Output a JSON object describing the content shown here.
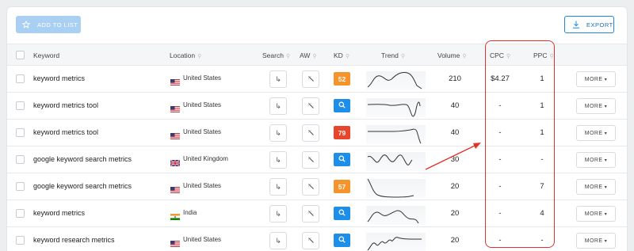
{
  "toolbar": {
    "add_to_list": "ADD TO LIST",
    "export": "EXPORT"
  },
  "columns": {
    "keyword": "Keyword",
    "location": "Location",
    "search": "Search",
    "aw": "AW",
    "kd": "KD",
    "trend": "Trend",
    "volume": "Volume",
    "cpc": "CPC",
    "ppc": "PPC",
    "pin_icon": "pin-icon"
  },
  "colors": {
    "kd_orange": "#f7932b",
    "kd_red": "#e9452c",
    "kd_blue": "#1e8fe8",
    "primary": "#1e88d8",
    "highlight": "#e0322a"
  },
  "rows": [
    {
      "keyword": "keyword metrics",
      "flag": "us",
      "location": "United States",
      "kd": "52",
      "kd_type": "orange",
      "volume": "210",
      "cpc": "$4.27",
      "ppc": "1",
      "more": "MORE"
    },
    {
      "keyword": "keyword metrics tool",
      "flag": "us",
      "location": "United States",
      "kd": "",
      "kd_type": "search",
      "volume": "40",
      "cpc": "-",
      "ppc": "1",
      "more": "MORE"
    },
    {
      "keyword": "keyword metrics tool",
      "flag": "us",
      "location": "United States",
      "kd": "79",
      "kd_type": "red",
      "volume": "40",
      "cpc": "-",
      "ppc": "1",
      "more": "MORE"
    },
    {
      "keyword": "google keyword search metrics",
      "flag": "uk",
      "location": "United Kingdom",
      "kd": "",
      "kd_type": "search",
      "volume": "30",
      "cpc": "-",
      "ppc": "-",
      "more": "MORE"
    },
    {
      "keyword": "google keyword search metrics",
      "flag": "us",
      "location": "United States",
      "kd": "57",
      "kd_type": "orange",
      "volume": "20",
      "cpc": "-",
      "ppc": "7",
      "more": "MORE"
    },
    {
      "keyword": "keyword metrics",
      "flag": "in",
      "location": "India",
      "kd": "",
      "kd_type": "search",
      "volume": "20",
      "cpc": "-",
      "ppc": "4",
      "more": "MORE"
    },
    {
      "keyword": "keyword research metrics",
      "flag": "us",
      "location": "United States",
      "kd": "",
      "kd_type": "search",
      "volume": "20",
      "cpc": "-",
      "ppc": "-",
      "more": "MORE"
    }
  ]
}
